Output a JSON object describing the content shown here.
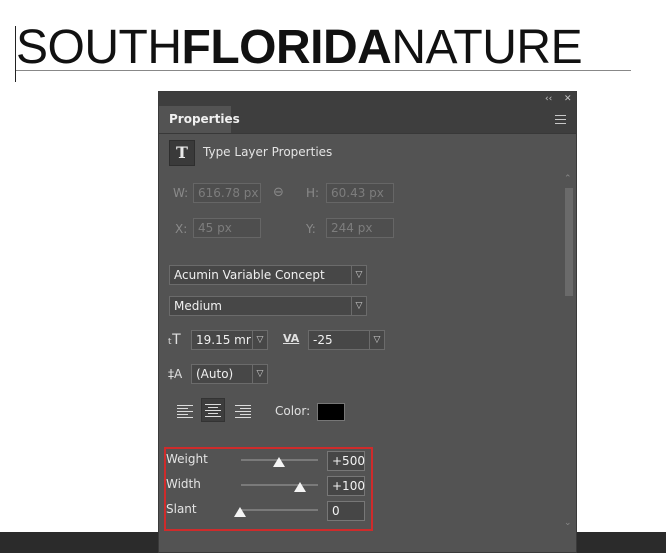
{
  "canvas": {
    "word1": "SOUTH",
    "word2": "FLORIDA",
    "word3": "NATURE"
  },
  "panel": {
    "collapse_glyph": "‹‹",
    "close_glyph": "✕",
    "tab_label": "Properties",
    "menu_icon": "hamburger-menu-icon",
    "kind_icon_glyph": "T",
    "kind_label": "Type Layer Properties",
    "transform": {
      "w_label": "W:",
      "w_value": "616.78 px",
      "h_label": "H:",
      "h_value": "60.43 px",
      "x_label": "X:",
      "x_value": "45 px",
      "y_label": "Y:",
      "y_value": "244 px",
      "link_icon": "link-icon"
    },
    "font_family": "Acumin Variable Concept",
    "font_style": "Medium",
    "font_size": "19.15 mr",
    "tracking": "-25",
    "leading": "(Auto)",
    "color_label": "Color:",
    "text_color": "#000000",
    "variable_axes": [
      {
        "label": "Weight",
        "value": "+500"
      },
      {
        "label": "Width",
        "value": "+100"
      },
      {
        "label": "Slant",
        "value": "0"
      }
    ]
  },
  "colors": {
    "panel_bg": "#535353",
    "panel_header": "#3e3e3e",
    "highlight": "#cf2b2b"
  }
}
